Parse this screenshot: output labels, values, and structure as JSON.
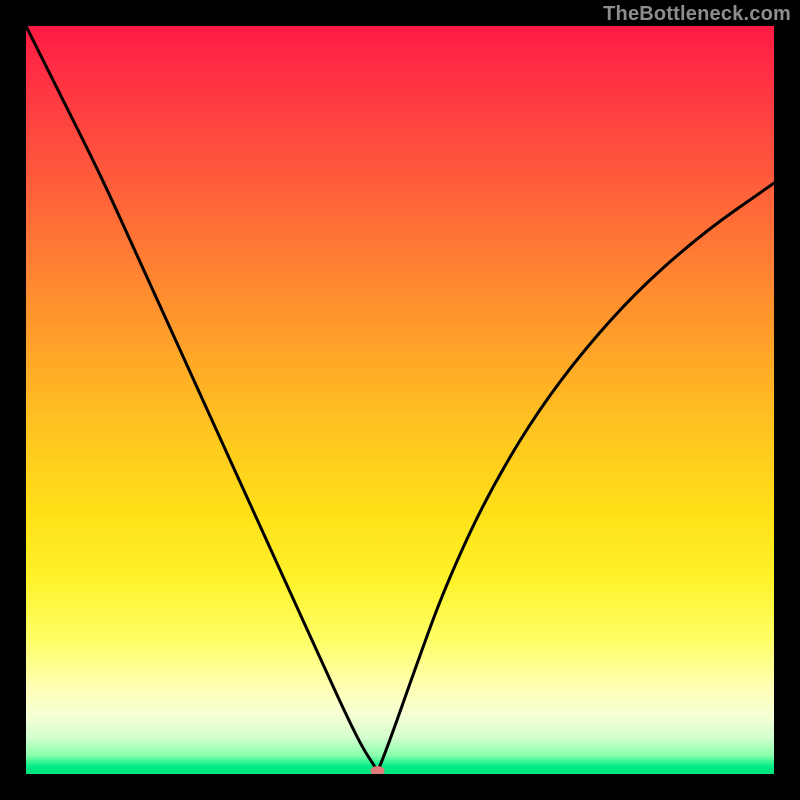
{
  "watermark": "TheBottleneck.com",
  "chart_data": {
    "type": "line",
    "title": "",
    "xlabel": "",
    "ylabel": "",
    "xlim": [
      0,
      100
    ],
    "ylim": [
      0,
      100
    ],
    "grid": false,
    "legend": false,
    "notes": "Rainbow gradient background (red top → green bottom). Single black V-shaped curve with minimum near x≈47, y≈0. Small pink marker at the minimum.",
    "series": [
      {
        "name": "curve",
        "color": "#000000",
        "x": [
          0,
          5,
          10,
          15,
          20,
          25,
          30,
          35,
          40,
          43,
          45,
          46.5,
          47,
          47.5,
          49,
          52,
          56,
          62,
          70,
          80,
          90,
          100
        ],
        "values": [
          100,
          90,
          80,
          69,
          58,
          47,
          36,
          25,
          14,
          7.5,
          3.5,
          1.2,
          0.4,
          1.5,
          5.5,
          14,
          25,
          38,
          51,
          63,
          72,
          79
        ]
      }
    ],
    "marker": {
      "x": 47,
      "y": 0.4,
      "color": "#e07b7b",
      "rx": 7,
      "ry": 5
    }
  }
}
